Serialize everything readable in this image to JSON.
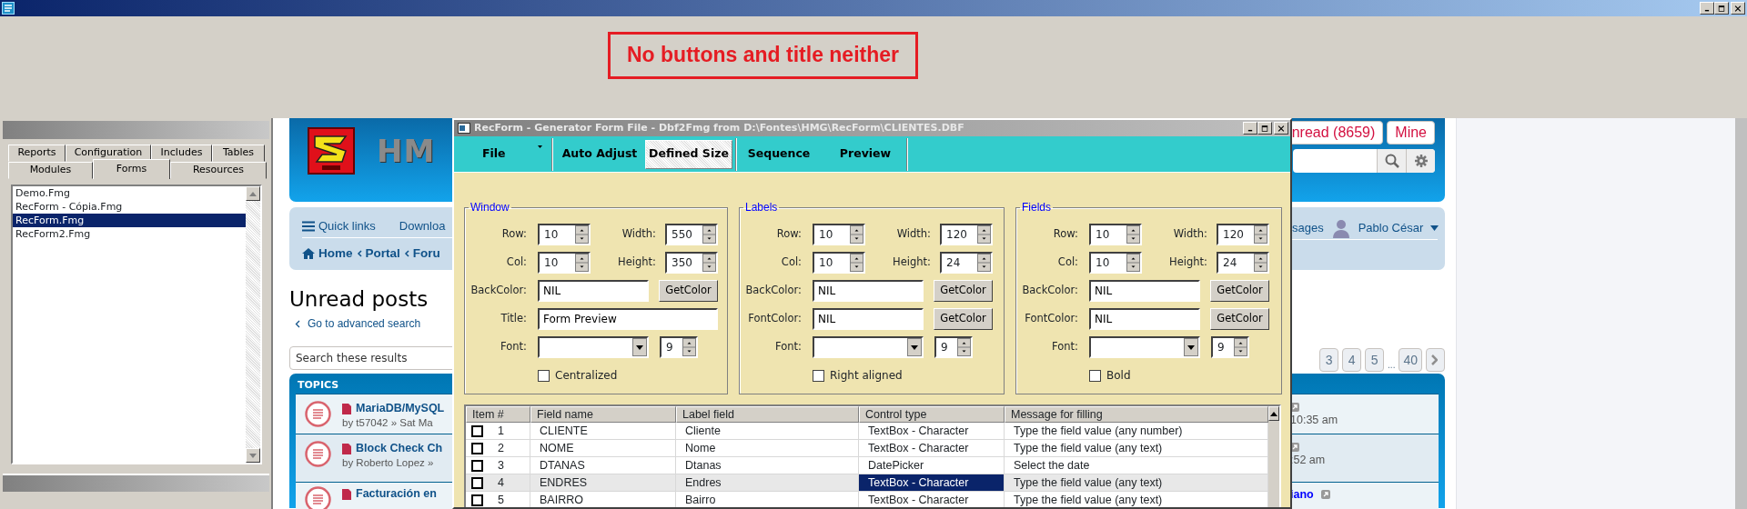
{
  "app_window": {
    "banner": "No buttons and title neither"
  },
  "side_panel": {
    "tab_rows": [
      [
        {
          "label": "Reports",
          "selected": false
        },
        {
          "label": "Configuration",
          "selected": false
        },
        {
          "label": "Includes",
          "selected": false
        },
        {
          "label": "Tables",
          "selected": false
        }
      ],
      [
        {
          "label": "Modules",
          "selected": false
        },
        {
          "label": "Forms",
          "selected": true
        },
        {
          "label": "Resources",
          "selected": false
        }
      ]
    ],
    "files": [
      {
        "name": "Demo.Fmg",
        "selected": false
      },
      {
        "name": "RecForm - Cópia.Fmg",
        "selected": false
      },
      {
        "name": "RecForm.Fmg",
        "selected": true
      },
      {
        "name": "RecForm2.Fmg",
        "selected": false
      }
    ]
  },
  "forum": {
    "logo_text": "HM",
    "header_buttons": [
      "nread (8659)",
      "Mine"
    ],
    "nav_links": [
      "Quick links",
      "Downloa"
    ],
    "breadcrumbs": [
      "Home",
      "Portal",
      "Foru"
    ],
    "messages_link": "sages",
    "user_name": "Pablo César",
    "heading": "Unread posts",
    "advanced_search": "Go to advanced search",
    "search": {
      "placeholder": "Search these results"
    },
    "pages": [
      {
        "label": "3",
        "kind": "page"
      },
      {
        "label": "4",
        "kind": "page"
      },
      {
        "label": "5",
        "kind": "page"
      },
      {
        "label": "...",
        "kind": "gap"
      },
      {
        "label": "40",
        "kind": "page"
      }
    ],
    "topics_header": "TOPICS",
    "topics": [
      {
        "title": "MariaDB/MySQL",
        "byline": "by t57042 » Sat Ma",
        "last_time": "10:35 am"
      },
      {
        "title": "Block Check Ch",
        "byline": "by Roberto Lopez »",
        "last_time": ":52 am"
      },
      {
        "title": "Facturación en",
        "last_author": "iano"
      }
    ]
  },
  "dialog": {
    "title": "RecForm - Generator Form File - Dbf2Fmg from D:\\Fontes\\HMG\\RecForm\\CLIENTES.DBF",
    "toolbar": [
      {
        "label": "File",
        "kind": "dropdown",
        "selected": false
      },
      {
        "label": "Auto Adjust",
        "kind": "button",
        "selected": false
      },
      {
        "label": "Defined Size",
        "kind": "button",
        "selected": true
      },
      {
        "label": "Sequence",
        "kind": "button",
        "selected": false
      },
      {
        "label": "Preview",
        "kind": "button",
        "selected": false
      }
    ],
    "groups": [
      {
        "title": "Window",
        "spinners": [
          {
            "label": "Row:",
            "value": "10"
          },
          {
            "label": "Width:",
            "value": "550"
          },
          {
            "label": "Col:",
            "value": "10"
          },
          {
            "label": "Height:",
            "value": "350"
          }
        ],
        "text_fields": [
          {
            "label": "BackColor:",
            "value": "NIL",
            "button": "GetColor"
          },
          {
            "label": "Title:",
            "value": "Form Preview"
          }
        ],
        "font_label": "Font:",
        "font_size": "9",
        "option": {
          "label": "Centralized",
          "checked": false
        }
      },
      {
        "title": "Labels",
        "spinners": [
          {
            "label": "Row:",
            "value": "10"
          },
          {
            "label": "Width:",
            "value": "120"
          },
          {
            "label": "Col:",
            "value": "10"
          },
          {
            "label": "Height:",
            "value": "24"
          }
        ],
        "text_fields": [
          {
            "label": "BackColor:",
            "value": "NIL",
            "button": "GetColor"
          },
          {
            "label": "FontColor:",
            "value": "NIL",
            "button": "GetColor"
          }
        ],
        "font_label": "Font:",
        "font_size": "9",
        "option": {
          "label": "Right aligned",
          "checked": false
        }
      },
      {
        "title": "Fields",
        "spinners": [
          {
            "label": "Row:",
            "value": "10"
          },
          {
            "label": "Width:",
            "value": "120"
          },
          {
            "label": "Col:",
            "value": "10"
          },
          {
            "label": "Height:",
            "value": "24"
          }
        ],
        "text_fields": [
          {
            "label": "BackColor:",
            "value": "NIL",
            "button": "GetColor"
          },
          {
            "label": "FontColor:",
            "value": "NIL",
            "button": "GetColor"
          }
        ],
        "font_label": "Font:",
        "font_size": "9",
        "option": {
          "label": "Bold",
          "checked": false
        }
      }
    ],
    "grid": {
      "columns": [
        "Item #",
        "Field name",
        "Label field",
        "Control type",
        "Message for filling"
      ],
      "rows": [
        {
          "checked": false,
          "item": "1",
          "field": "CLIENTE",
          "label": "Cliente",
          "control": "TextBox - Character",
          "message": "Type the field value (any number)",
          "selected": false
        },
        {
          "checked": false,
          "item": "2",
          "field": "NOME",
          "label": "Nome",
          "control": "TextBox - Character",
          "message": "Type the field value (any text)",
          "selected": false
        },
        {
          "checked": false,
          "item": "3",
          "field": "DTANAS",
          "label": "Dtanas",
          "control": "DatePicker",
          "message": "Select the date",
          "selected": false
        },
        {
          "checked": false,
          "item": "4",
          "field": "ENDRES",
          "label": "Endres",
          "control": "TextBox - Character",
          "message": "Type the field value (any text)",
          "selected": true
        },
        {
          "checked": false,
          "item": "5",
          "field": "BAIRRO",
          "label": "Bairro",
          "control": "TextBox - Character",
          "message": "Type the field value (any text)",
          "selected": false
        }
      ]
    }
  }
}
